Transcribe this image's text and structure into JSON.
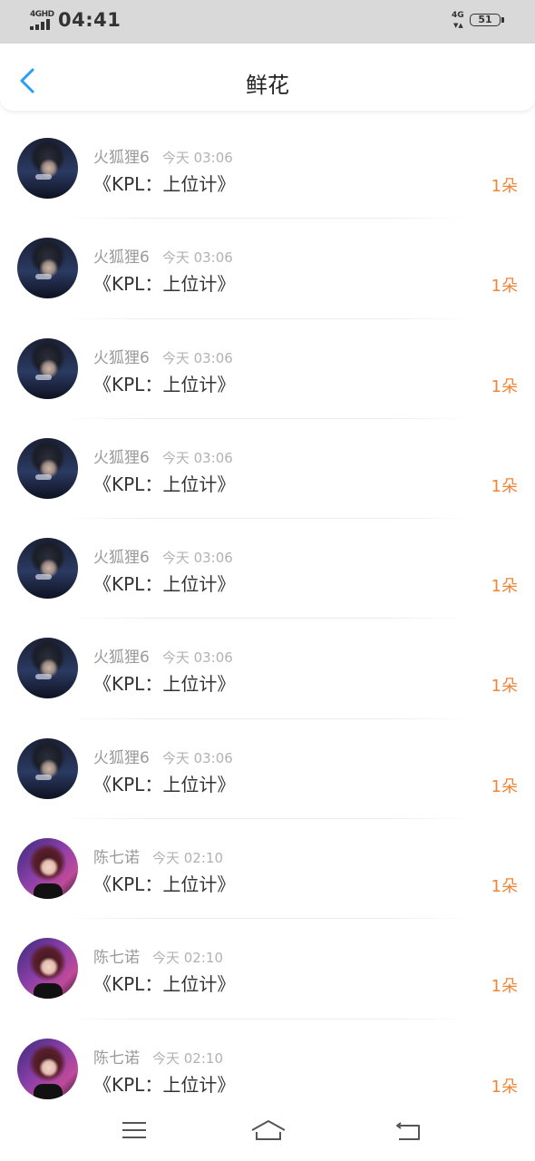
{
  "status_bar": {
    "network_label": "4GHD",
    "time": "04:41",
    "network_right": "4G",
    "battery": "51"
  },
  "header": {
    "back_icon": "chevron-left-icon",
    "title": "鲜花",
    "accent_color": "#2a9df4"
  },
  "records": [
    {
      "user": "火狐狸6",
      "time": "今天 03:06",
      "book": "《KPL：上位计》",
      "amount": "1朵",
      "avatar": "a1"
    },
    {
      "user": "火狐狸6",
      "time": "今天 03:06",
      "book": "《KPL：上位计》",
      "amount": "1朵",
      "avatar": "a1"
    },
    {
      "user": "火狐狸6",
      "time": "今天 03:06",
      "book": "《KPL：上位计》",
      "amount": "1朵",
      "avatar": "a1"
    },
    {
      "user": "火狐狸6",
      "time": "今天 03:06",
      "book": "《KPL：上位计》",
      "amount": "1朵",
      "avatar": "a1"
    },
    {
      "user": "火狐狸6",
      "time": "今天 03:06",
      "book": "《KPL：上位计》",
      "amount": "1朵",
      "avatar": "a1"
    },
    {
      "user": "火狐狸6",
      "time": "今天 03:06",
      "book": "《KPL：上位计》",
      "amount": "1朵",
      "avatar": "a1"
    },
    {
      "user": "火狐狸6",
      "time": "今天 03:06",
      "book": "《KPL：上位计》",
      "amount": "1朵",
      "avatar": "a1"
    },
    {
      "user": "陈七诺",
      "time": "今天 02:10",
      "book": "《KPL：上位计》",
      "amount": "1朵",
      "avatar": "a2"
    },
    {
      "user": "陈七诺",
      "time": "今天 02:10",
      "book": "《KPL：上位计》",
      "amount": "1朵",
      "avatar": "a2"
    },
    {
      "user": "陈七诺",
      "time": "今天 02:10",
      "book": "《KPL：上位计》",
      "amount": "1朵",
      "avatar": "a2"
    }
  ],
  "colors": {
    "amount": "#f08437",
    "meta": "#9a9a9a",
    "status_bar_bg": "#d9d9d9"
  },
  "nav_bar": {
    "icons": [
      "menu-icon",
      "home-icon",
      "back-return-icon"
    ]
  }
}
